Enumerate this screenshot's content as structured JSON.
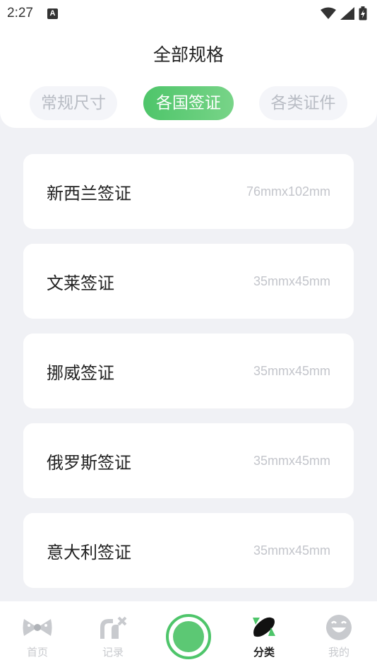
{
  "status": {
    "time": "2:27",
    "notif_icon": "A"
  },
  "header": {
    "title": "全部规格",
    "tabs": [
      "常规尺寸",
      "各国签证",
      "各类证件"
    ],
    "active_tab": 1
  },
  "specs": [
    {
      "name": "新西兰签证",
      "size": "76mmx102mm"
    },
    {
      "name": "文莱签证",
      "size": "35mmx45mm"
    },
    {
      "name": "挪威签证",
      "size": "35mmx45mm"
    },
    {
      "name": "俄罗斯签证",
      "size": "35mmx45mm"
    },
    {
      "name": "意大利签证",
      "size": "35mmx45mm"
    }
  ],
  "nav": {
    "home": "首页",
    "records": "记录",
    "category": "分类",
    "mine": "我的",
    "active": "category"
  },
  "colors": {
    "accent": "#5cc874",
    "inactive": "#c8cace"
  }
}
